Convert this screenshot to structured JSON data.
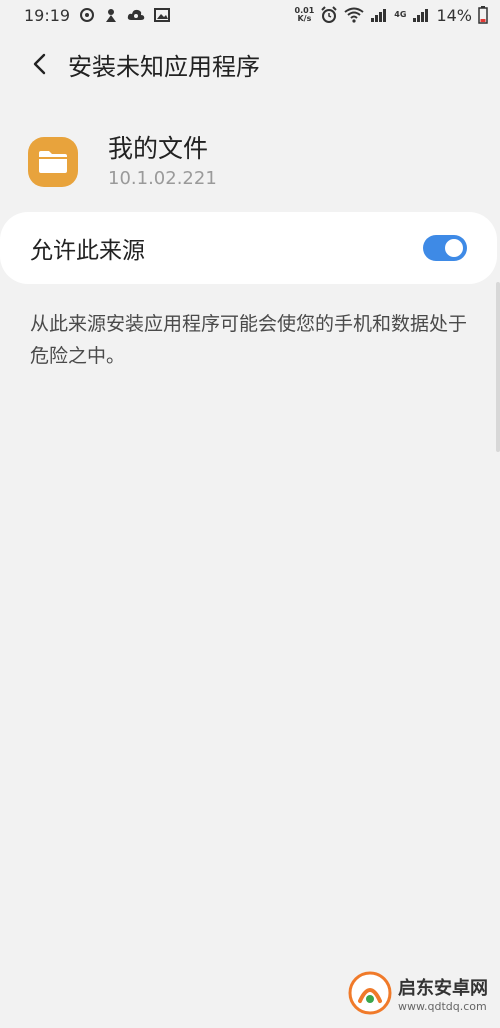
{
  "status_bar": {
    "time": "19:19",
    "net_speed_value": "0.01",
    "net_speed_unit": "K/s",
    "network_label": "4G",
    "battery_percent": "14%",
    "icons": [
      "sync-icon",
      "alert-icon",
      "cloud-icon",
      "image-icon",
      "alarm-icon",
      "wifi-icon",
      "signal-icon",
      "battery-icon"
    ]
  },
  "header": {
    "title": "安装未知应用程序",
    "back_icon": "chevron-left-icon"
  },
  "app": {
    "name": "我的文件",
    "version": "10.1.02.221",
    "icon": "folder-icon",
    "icon_color": "#e8a33c"
  },
  "setting": {
    "label": "允许此来源",
    "enabled": true,
    "accent_color": "#3e8ae6"
  },
  "warning": {
    "text": "从此来源安装应用程序可能会使您的手机和数据处于危险之中。"
  },
  "watermark": {
    "name": "启东安卓网",
    "url": "www.qdtdq.com"
  }
}
